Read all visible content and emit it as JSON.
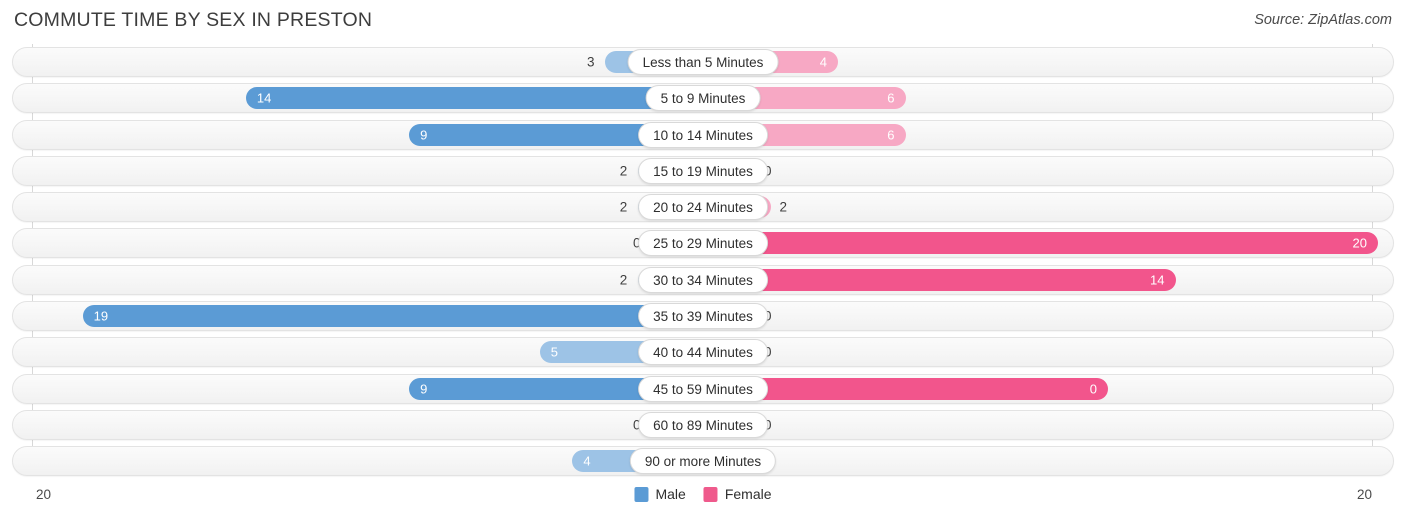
{
  "header": {
    "title": "COMMUTE TIME BY SEX IN PRESTON",
    "source": "Source: ZipAtlas.com"
  },
  "axis": {
    "left_max_label": "20",
    "right_max_label": "20"
  },
  "legend": {
    "items": [
      {
        "label": "Male",
        "color": "#5b9bd5"
      },
      {
        "label": "Female",
        "color": "#ef5a8c"
      }
    ]
  },
  "colors": {
    "male_strong": "#5b9bd5",
    "male_light": "#9dc3e6",
    "female_strong": "#f2558c",
    "female_light": "#f7a8c4",
    "track_border": "#e3e3e3",
    "gridline": "#d8d8d8"
  },
  "chart_data": {
    "type": "bar",
    "title": "COMMUTE TIME BY SEX IN PRESTON",
    "subtitle": "",
    "xlabel": "",
    "ylabel": "",
    "orientation": "horizontal-diverging",
    "grid": true,
    "legend_position": "bottom-center",
    "axis_max": 20,
    "xlim": [
      20,
      20
    ],
    "categories": [
      "Less than 5 Minutes",
      "5 to 9 Minutes",
      "10 to 14 Minutes",
      "15 to 19 Minutes",
      "20 to 24 Minutes",
      "25 to 29 Minutes",
      "30 to 34 Minutes",
      "35 to 39 Minutes",
      "40 to 44 Minutes",
      "45 to 59 Minutes",
      "60 to 89 Minutes",
      "90 or more Minutes"
    ],
    "series": [
      {
        "name": "Male",
        "values": [
          3,
          14,
          9,
          2,
          2,
          0,
          2,
          19,
          5,
          9,
          0,
          4
        ]
      },
      {
        "name": "Female",
        "values": [
          4,
          6,
          6,
          0,
          2,
          20,
          14,
          0,
          0,
          12,
          0,
          0
        ]
      }
    ]
  },
  "rows": [
    {
      "label": "Less than 5 Minutes",
      "male": "3",
      "female": "4"
    },
    {
      "label": "5 to 9 Minutes",
      "male": "14",
      "female": "6"
    },
    {
      "label": "10 to 14 Minutes",
      "male": "9",
      "female": "6"
    },
    {
      "label": "15 to 19 Minutes",
      "male": "2",
      "female": "0"
    },
    {
      "label": "20 to 24 Minutes",
      "male": "2",
      "female": "2"
    },
    {
      "label": "25 to 29 Minutes",
      "male": "0",
      "female": "20"
    },
    {
      "label": "30 to 34 Minutes",
      "male": "2",
      "female": "14"
    },
    {
      "label": "35 to 39 Minutes",
      "male": "19",
      "female": "0"
    },
    {
      "label": "40 to 44 Minutes",
      "male": "5",
      "female": "0"
    },
    {
      "label": "45 to 59 Minutes",
      "male": "9",
      "female": "0"
    },
    {
      "label": "60 to 89 Minutes",
      "male": "0",
      "female": "0"
    },
    {
      "label": "90 or more Minutes",
      "male": "4",
      "female": "0"
    }
  ]
}
